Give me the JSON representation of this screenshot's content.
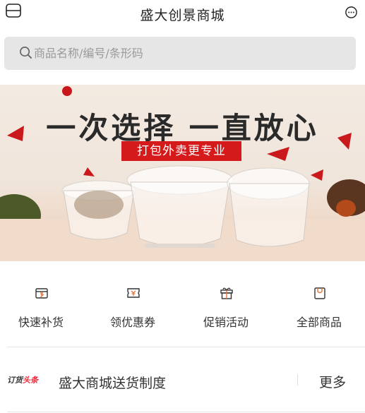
{
  "header": {
    "title": "盛大创景商城",
    "menu_icon": "menu-icon",
    "chat_icon": "chat-bubble-icon"
  },
  "search": {
    "placeholder": "商品名称/编号/条形码",
    "icon": "search-icon"
  },
  "banner": {
    "slogan": "一次选择 一直放心",
    "tag": "打包外卖更专业",
    "accent": "#d41a1a"
  },
  "categories": [
    {
      "label": "快速补货",
      "icon": "restock-box-icon"
    },
    {
      "label": "领优惠券",
      "icon": "coupon-icon"
    },
    {
      "label": "促销活动",
      "icon": "gift-icon"
    },
    {
      "label": "全部商品",
      "icon": "shopping-bag-icon"
    }
  ],
  "news": {
    "badge_black": "订货",
    "badge_red": "头条",
    "title": "盛大商城送货制度",
    "more": "更多"
  },
  "colors": {
    "accent_red": "#e23a2a",
    "icon_orange": "#e8733a",
    "search_bg": "#e6e6e6"
  }
}
